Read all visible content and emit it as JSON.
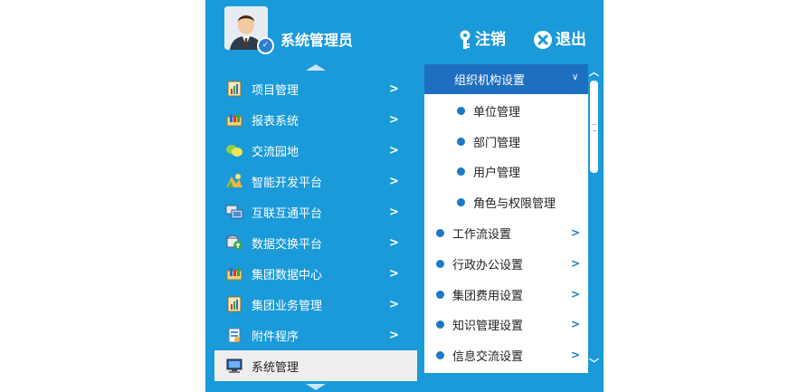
{
  "header": {
    "username": "系统管理员",
    "logout_label": "注销",
    "exit_label": "退出"
  },
  "menu": [
    {
      "label": "项目管理",
      "icon": "chart-book-icon",
      "arrow": ">"
    },
    {
      "label": "报表系统",
      "icon": "report-folder-icon",
      "arrow": ">"
    },
    {
      "label": "交流园地",
      "icon": "chat-bubbles-icon",
      "arrow": ">"
    },
    {
      "label": "智能开发平台",
      "icon": "dev-platform-icon",
      "arrow": ">"
    },
    {
      "label": "互联互通平台",
      "icon": "network-icon",
      "arrow": ">"
    },
    {
      "label": "数据交换平台",
      "icon": "data-exchange-icon",
      "arrow": ">"
    },
    {
      "label": "集团数据中心",
      "icon": "data-center-icon",
      "arrow": ">"
    },
    {
      "label": "集团业务管理",
      "icon": "business-book-icon",
      "arrow": ">"
    },
    {
      "label": "附件程序",
      "icon": "attachment-icon",
      "arrow": ">"
    },
    {
      "label": "系统管理",
      "icon": "monitor-icon",
      "arrow": ""
    }
  ],
  "submenu": {
    "open_group": "组织机构设置",
    "open_items": [
      "单位管理",
      "部门管理",
      "用户管理",
      "角色与权限管理"
    ],
    "groups": [
      "工作流设置",
      "行政办公设置",
      "集团费用设置",
      "知识管理设置",
      "信息交流设置"
    ],
    "group_arrow": ">",
    "open_chevron": "∨"
  },
  "colors": {
    "panel_bg": "#1a9ad9",
    "submenu_head": "#1e6fbf",
    "active_item_bg": "#eeeeee",
    "bullet": "#1b79c7"
  }
}
